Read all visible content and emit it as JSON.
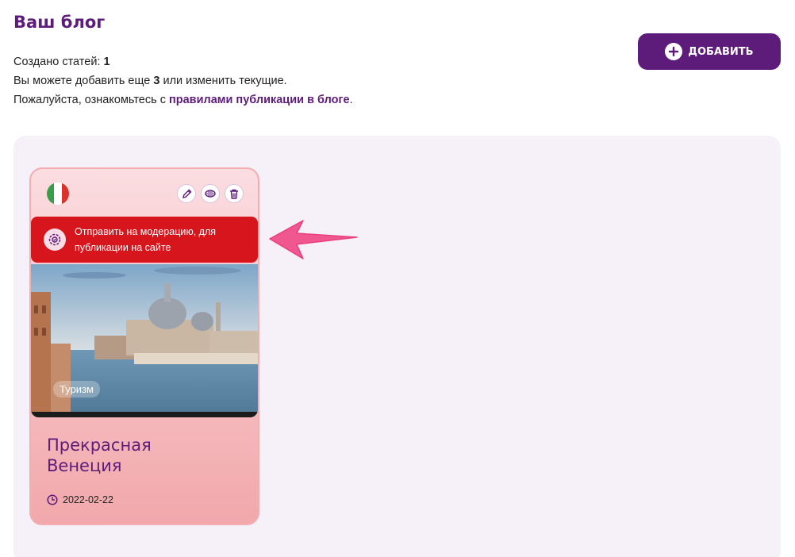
{
  "header": {
    "title": "Ваш блог",
    "articles_created_label": "Создано статей: ",
    "articles_created_count": "1",
    "can_add_prefix": "Вы можете добавить еще ",
    "can_add_count": "3",
    "can_add_suffix": " или изменить текущие.",
    "rules_prefix": "Пожалуйста, ознакомьтесь с ",
    "rules_link": "правилами публикации в блоге",
    "rules_suffix": "."
  },
  "toolbar": {
    "add_label": "ДОБАВИТЬ"
  },
  "card": {
    "country_flag": "italy-flag-icon",
    "moderation_text": "Отправить на модерацию, для публикации на сайте",
    "category": "Туризм",
    "title": "Прекрасная Венеция",
    "date": "2022-02-22",
    "actions": [
      "edit-icon",
      "preview-icon",
      "trash-icon"
    ]
  },
  "colors": {
    "brand": "#5e1c7a",
    "moderation_bg": "#d7151d",
    "arrow": "#f0578e",
    "panel_bg": "#f6f1f8"
  }
}
